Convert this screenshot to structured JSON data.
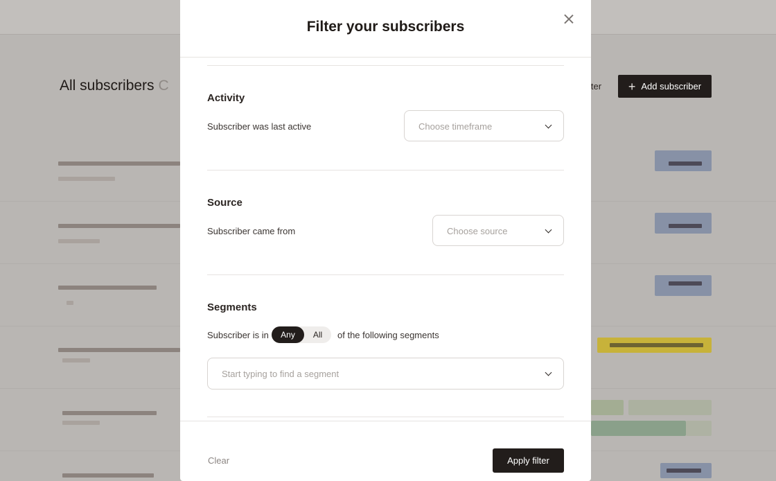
{
  "background": {
    "page_title": "All subscribers",
    "page_title_suffix": "C",
    "filter_label": "lter",
    "add_button_label": "Add subscriber",
    "colors": {
      "overlay": "#b9b6b3",
      "dark": "#221d1b"
    }
  },
  "modal": {
    "title": "Filter your subscribers",
    "activity": {
      "heading": "Activity",
      "label": "Subscriber was last active",
      "placeholder": "Choose timeframe"
    },
    "source": {
      "heading": "Source",
      "label": "Subscriber came from",
      "placeholder": "Choose source"
    },
    "segments": {
      "heading": "Segments",
      "label_prefix": "Subscriber is in",
      "toggle_any": "Any",
      "toggle_all": "All",
      "toggle_selected": "Any",
      "label_suffix": "of the following segments",
      "placeholder": "Start typing to find a segment"
    },
    "footer": {
      "clear_label": "Clear",
      "apply_label": "Apply filter"
    }
  }
}
